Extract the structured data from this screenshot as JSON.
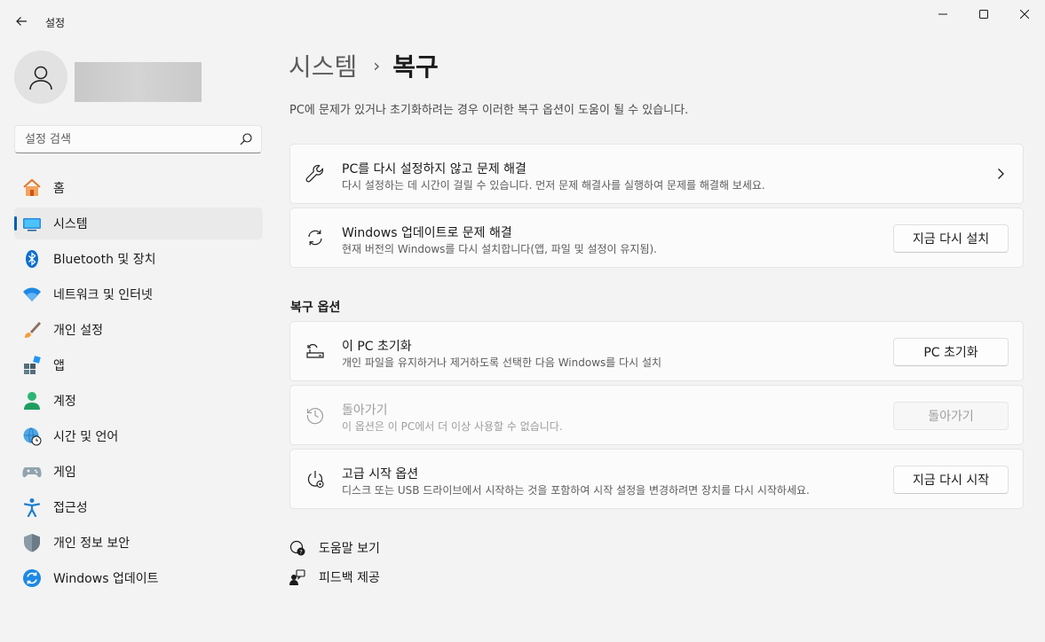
{
  "app": {
    "title": "설정"
  },
  "search": {
    "placeholder": "설정 검색"
  },
  "sidebar": {
    "items": [
      {
        "label": "홈"
      },
      {
        "label": "시스템"
      },
      {
        "label": "Bluetooth 및 장치"
      },
      {
        "label": "네트워크 및 인터넷"
      },
      {
        "label": "개인 설정"
      },
      {
        "label": "앱"
      },
      {
        "label": "계정"
      },
      {
        "label": "시간 및 언어"
      },
      {
        "label": "게임"
      },
      {
        "label": "접근성"
      },
      {
        "label": "개인 정보 보안"
      },
      {
        "label": "Windows 업데이트"
      }
    ],
    "active_index": 1
  },
  "main": {
    "breadcrumb_parent": "시스템",
    "breadcrumb_sep": "›",
    "breadcrumb_current": "복구",
    "description": "PC에 문제가 있거나 초기화하려는 경우 이러한 복구 옵션이 도움이 될 수 있습니다.",
    "cards": [
      {
        "title": "PC를 다시 설정하지 않고 문제 해결",
        "subtitle": "다시 설정하는 데 시간이 걸릴 수 있습니다. 먼저 문제 해결사를 실행하여 문제를 해결해 보세요.",
        "icon": "wrench-icon"
      },
      {
        "title": "Windows 업데이트로 문제 해결",
        "subtitle": "현재 버전의 Windows를 다시 설치합니다(앱, 파일 및 설정이 유지됨).",
        "button": "지금 다시 설치",
        "icon": "refresh-icon"
      }
    ],
    "section_title": "복구 옵션",
    "options": [
      {
        "title": "이 PC 초기화",
        "subtitle": "개인 파일을 유지하거나 제거하도록 선택한 다음 Windows를 다시 설치",
        "button": "PC 초기화",
        "icon": "reset-pc-icon"
      },
      {
        "title": "돌아가기",
        "subtitle": "이 옵션은 이 PC에서 더 이상 사용할 수 없습니다.",
        "button": "돌아가기",
        "disabled": true,
        "icon": "history-icon"
      },
      {
        "title": "고급 시작 옵션",
        "subtitle": "디스크 또는 USB 드라이브에서 시작하는 것을 포함하여 시작 설정을 변경하려면 장치를 다시 시작하세요.",
        "button": "지금 다시 시작",
        "icon": "advanced-startup-icon"
      }
    ],
    "links": [
      {
        "label": "도움말 보기",
        "icon": "help-icon"
      },
      {
        "label": "피드백 제공",
        "icon": "feedback-icon"
      }
    ]
  },
  "colors": {
    "accent": "#005fb8",
    "background": "#f3f3f3",
    "card": "#fbfbfb"
  }
}
